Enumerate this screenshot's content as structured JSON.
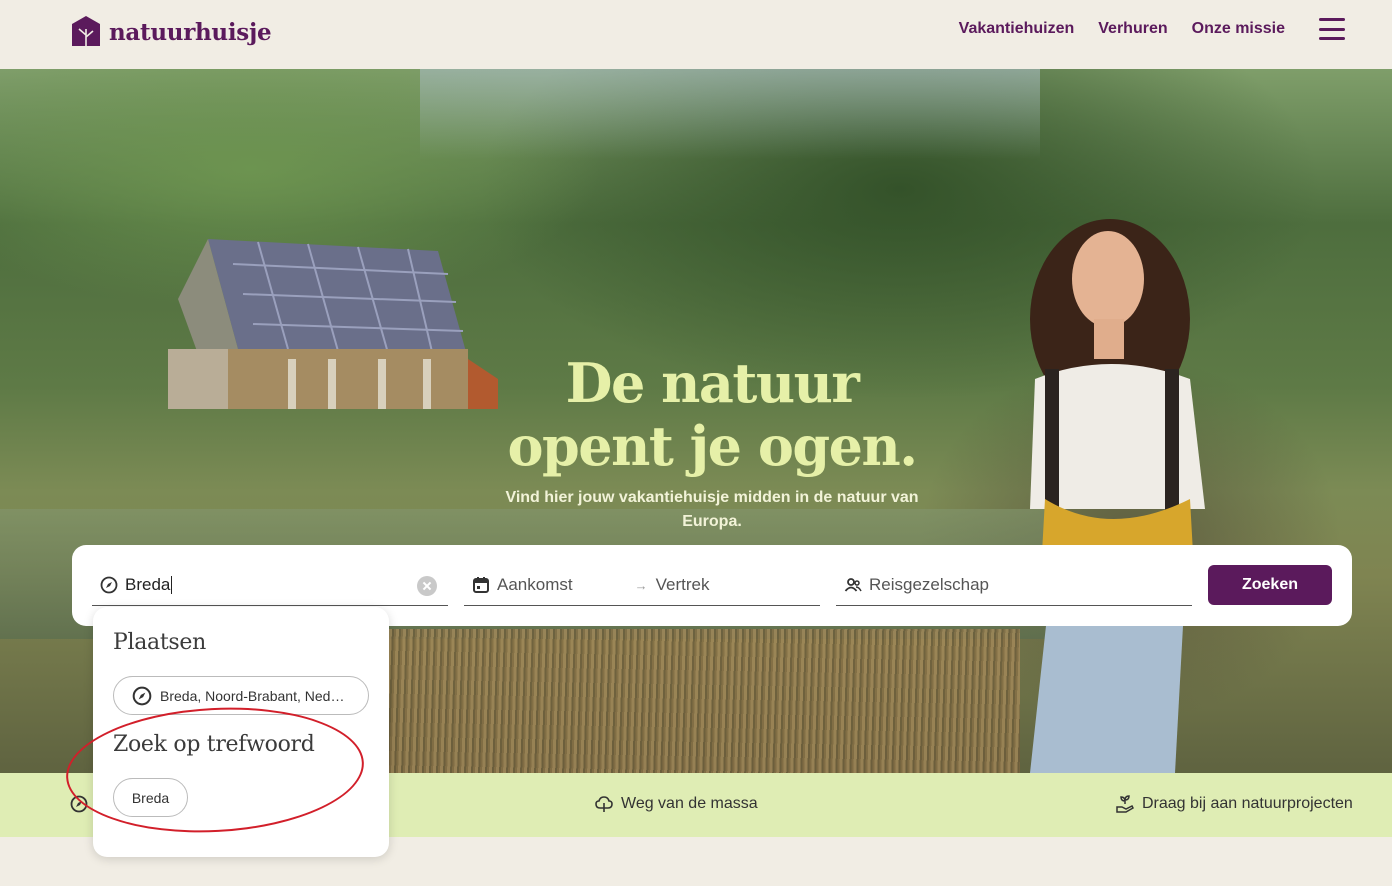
{
  "header": {
    "brand": "natuurhuisje",
    "nav": [
      "Vakantiehuizen",
      "Verhuren",
      "Onze missie"
    ],
    "menu_icon": "hamburger-menu-icon"
  },
  "hero": {
    "title": "De natuur opent je ogen.",
    "subtitle": "Vind hier jouw vakantiehuisje midden in de natuur van Europa."
  },
  "search": {
    "location_value": "Breda",
    "arrival_placeholder": "Aankomst",
    "departure_placeholder": "Vertrek",
    "guests_placeholder": "Reisgezelschap",
    "submit_label": "Zoeken"
  },
  "dropdown": {
    "places_heading": "Plaatsen",
    "place_suggestion": "Breda, Noord-Brabant, Nederland",
    "keyword_heading": "Zoek op trefwoord",
    "keyword_suggestion": "Breda"
  },
  "benefits": {
    "item2": "Weg van de massa",
    "item3": "Draag bij aan natuurprojecten"
  },
  "colors": {
    "brand_purple": "#5b1a5c",
    "hero_title": "#e6f0a8",
    "benefit_bar": "#dfedb4",
    "annotation_red": "#d21f2a"
  }
}
